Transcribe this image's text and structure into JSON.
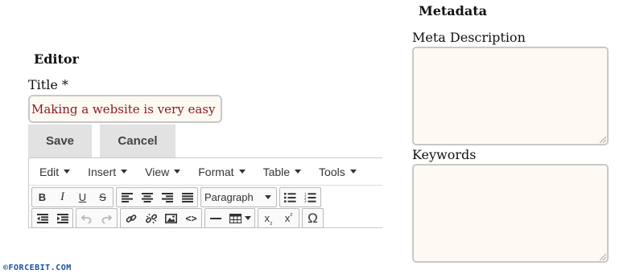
{
  "editor_section": {
    "heading": "Editor",
    "title_label": "Title *",
    "title_value": "Making a website is very easy",
    "save_label": "Save",
    "cancel_label": "Cancel"
  },
  "menubar": {
    "items": [
      {
        "label": "Edit"
      },
      {
        "label": "Insert"
      },
      {
        "label": "View"
      },
      {
        "label": "Format"
      },
      {
        "label": "Table"
      },
      {
        "label": "Tools"
      }
    ]
  },
  "toolbar": {
    "bold": "B",
    "italic": "I",
    "underline": "U",
    "strike": "S",
    "format_select": "Paragraph",
    "subscript": "x",
    "subscript_mark": "₂",
    "superscript": "x",
    "superscript_mark": "²",
    "special_char": "Ω",
    "code": "<>"
  },
  "metadata": {
    "heading": "Metadata",
    "description_label": "Meta Description",
    "description_value": "",
    "keywords_label": "Keywords",
    "keywords_value": ""
  },
  "watermark": "©FORCEBIT.COM",
  "colors": {
    "title_text": "#8b1a1a",
    "field_bg": "#fdf9f3",
    "button_bg": "#e2e2e2",
    "watermark": "#1c4fa3"
  }
}
